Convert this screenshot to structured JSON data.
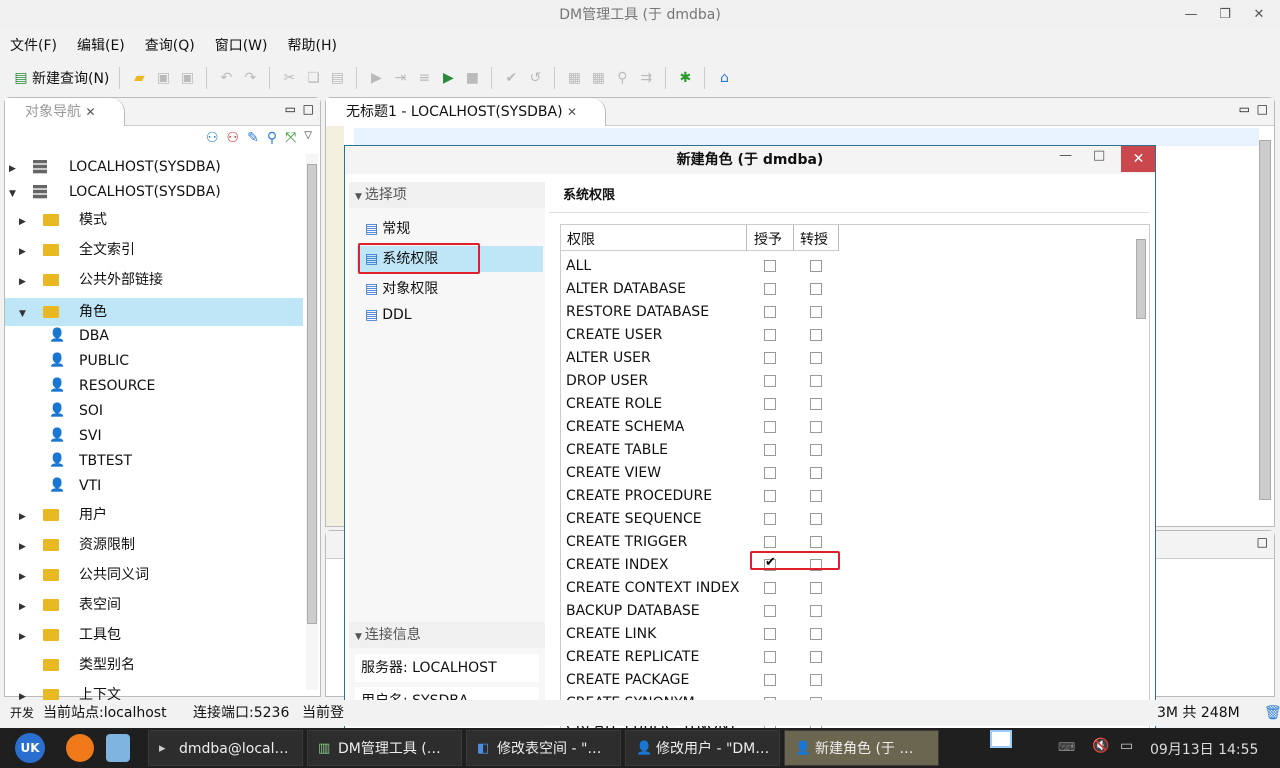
{
  "window": {
    "title": "DM管理工具 (于 dmdba)"
  },
  "menu": [
    "文件(F)",
    "编辑(E)",
    "查询(Q)",
    "窗口(W)",
    "帮助(H)"
  ],
  "toolbar": {
    "new_query": "新建查询(N)"
  },
  "navigator": {
    "tab": "对象导航",
    "tree": [
      {
        "label": "LOCALHOST(SYSDBA)",
        "level": 0,
        "type": "db",
        "expanded": false
      },
      {
        "label": "LOCALHOST(SYSDBA)",
        "level": 0,
        "type": "db",
        "expanded": true
      },
      {
        "label": "模式",
        "level": 1,
        "type": "folder"
      },
      {
        "label": "全文索引",
        "level": 1,
        "type": "folder"
      },
      {
        "label": "公共外部链接",
        "level": 1,
        "type": "folder"
      },
      {
        "label": "角色",
        "level": 1,
        "type": "folder",
        "expanded": true,
        "selected": true
      },
      {
        "label": "DBA",
        "level": 2,
        "type": "role"
      },
      {
        "label": "PUBLIC",
        "level": 2,
        "type": "role"
      },
      {
        "label": "RESOURCE",
        "level": 2,
        "type": "role"
      },
      {
        "label": "SOI",
        "level": 2,
        "type": "role"
      },
      {
        "label": "SVI",
        "level": 2,
        "type": "role"
      },
      {
        "label": "TBTEST",
        "level": 2,
        "type": "role"
      },
      {
        "label": "VTI",
        "level": 2,
        "type": "role"
      },
      {
        "label": "用户",
        "level": 1,
        "type": "folder"
      },
      {
        "label": "资源限制",
        "level": 1,
        "type": "folder"
      },
      {
        "label": "公共同义词",
        "level": 1,
        "type": "folder"
      },
      {
        "label": "表空间",
        "level": 1,
        "type": "folder"
      },
      {
        "label": "工具包",
        "level": 1,
        "type": "folder"
      },
      {
        "label": "类型别名",
        "level": 1,
        "type": "folder",
        "leaf": true
      },
      {
        "label": "上下文",
        "level": 1,
        "type": "folder"
      }
    ]
  },
  "editor": {
    "tab": "无标题1 - LOCALHOST(SYSDBA)"
  },
  "dialog": {
    "title": "新建角色  (于 dmdba)",
    "nav_header": "选择项",
    "nav_items": [
      "常规",
      "系统权限",
      "对象权限",
      "DDL"
    ],
    "selected_nav": "系统权限",
    "conn_header": "连接信息",
    "server": "服务器: LOCALHOST",
    "user": "用户名: SYSDBA",
    "section_title": "系统权限",
    "columns": [
      "权限",
      "授予",
      "转授"
    ],
    "permissions": [
      {
        "name": "ALL",
        "grant": false,
        "regrant": false
      },
      {
        "name": "ALTER DATABASE",
        "grant": false,
        "regrant": false
      },
      {
        "name": "RESTORE DATABASE",
        "grant": false,
        "regrant": false
      },
      {
        "name": "CREATE USER",
        "grant": false,
        "regrant": false
      },
      {
        "name": "ALTER USER",
        "grant": false,
        "regrant": false
      },
      {
        "name": "DROP USER",
        "grant": false,
        "regrant": false
      },
      {
        "name": "CREATE ROLE",
        "grant": false,
        "regrant": false
      },
      {
        "name": "CREATE SCHEMA",
        "grant": false,
        "regrant": false
      },
      {
        "name": "CREATE TABLE",
        "grant": false,
        "regrant": false
      },
      {
        "name": "CREATE VIEW",
        "grant": false,
        "regrant": false
      },
      {
        "name": "CREATE PROCEDURE",
        "grant": false,
        "regrant": false
      },
      {
        "name": "CREATE SEQUENCE",
        "grant": false,
        "regrant": false
      },
      {
        "name": "CREATE TRIGGER",
        "grant": false,
        "regrant": false
      },
      {
        "name": "CREATE INDEX",
        "grant": true,
        "regrant": false
      },
      {
        "name": "CREATE CONTEXT INDEX",
        "grant": false,
        "regrant": false
      },
      {
        "name": "BACKUP DATABASE",
        "grant": false,
        "regrant": false
      },
      {
        "name": "CREATE LINK",
        "grant": false,
        "regrant": false
      },
      {
        "name": "CREATE REPLICATE",
        "grant": false,
        "regrant": false
      },
      {
        "name": "CREATE PACKAGE",
        "grant": false,
        "regrant": false
      },
      {
        "name": "CREATE SYNONYM",
        "grant": false,
        "regrant": false
      },
      {
        "name": "CREATE PUBLIC SYNONY",
        "grant": false,
        "regrant": false
      }
    ]
  },
  "status": {
    "mode": "开发",
    "site": "当前站点:localhost",
    "port": "连接端口:5236",
    "login": "当前登",
    "memory": "3M 共 248M"
  },
  "taskbar": {
    "tasks": [
      "dmdba@local…",
      "DM管理工具 (…",
      "修改表空间 - \"…",
      "修改用户 - \"DM…",
      "新建角色  (于 …"
    ],
    "clock": "09月13日 14:55"
  },
  "colors": {
    "selection": "#bfe6f7",
    "highlight_box": "#e0202a",
    "close_button": "#c9474d",
    "taskbar": "#1f1f1f"
  }
}
